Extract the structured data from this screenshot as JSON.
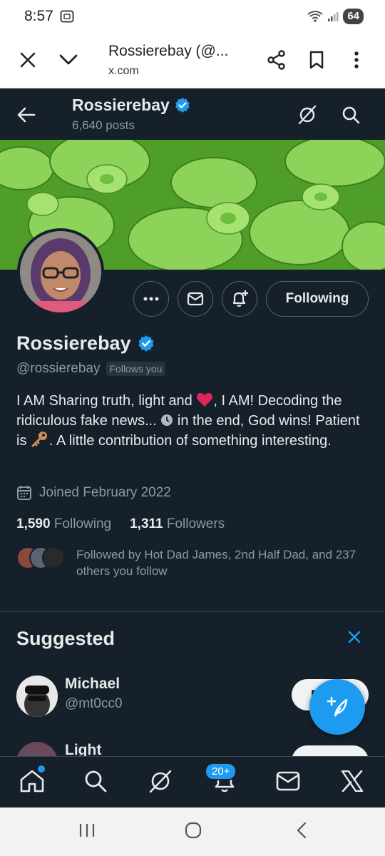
{
  "status_bar": {
    "time": "8:57",
    "battery": "64"
  },
  "browser": {
    "title": "Rossierebay (@...",
    "url": "x.com"
  },
  "header": {
    "name": "Rossierebay",
    "posts": "6,640 posts"
  },
  "profile": {
    "name": "Rossierebay",
    "handle": "@rossierebay",
    "follows_you": "Follows you",
    "following_button": "Following",
    "bio_part1": "I AM Sharing truth, light and ",
    "bio_part2": ", I AM! Decoding the ridiculous fake news... ",
    "bio_part3": " in the end, God wins! Patient is ",
    "bio_part4": ". A little contribution of something interesting.",
    "joined": "Joined February 2022",
    "following_count": "1,590",
    "following_label": "Following",
    "followers_count": "1,311",
    "followers_label": "Followers",
    "followed_by": "Followed by Hot Dad James, 2nd Half Dad, and 237 others you follow"
  },
  "suggested": {
    "title": "Suggested",
    "items": [
      {
        "name": "Michael",
        "handle": "@mt0cc0",
        "button": "Follow"
      },
      {
        "name": "Light",
        "handle": "",
        "button": "Follow"
      }
    ]
  },
  "bottom_nav": {
    "notifications_badge": "20+"
  },
  "colors": {
    "background": "#15202b",
    "accent": "#1d9bf0",
    "text": "#e7e9ea",
    "muted": "#8b98a5"
  },
  "icons": [
    "close-icon",
    "chevron-down-icon",
    "share-icon",
    "bookmark-icon",
    "more-vert-icon",
    "back-arrow-icon",
    "grok-icon",
    "search-icon",
    "verified-icon",
    "more-icon",
    "mail-icon",
    "bell-plus-icon",
    "calendar-icon",
    "close-x-icon",
    "compose-icon",
    "home-icon",
    "bell-icon",
    "x-logo-icon"
  ]
}
